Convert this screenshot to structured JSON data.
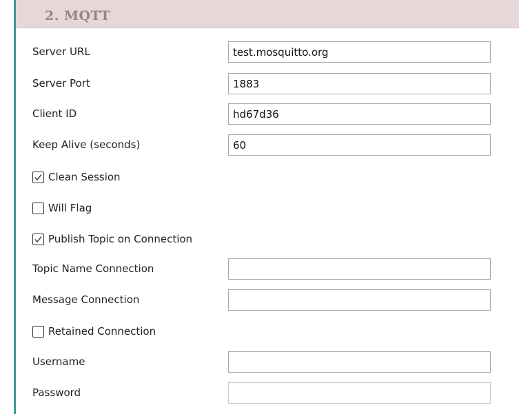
{
  "section": {
    "title": "2. MQTT"
  },
  "fields": {
    "server_url": {
      "label": "Server URL",
      "value": "test.mosquitto.org"
    },
    "server_port": {
      "label": "Server Port",
      "value": "1883"
    },
    "client_id": {
      "label": "Client ID",
      "value": "hd67d36"
    },
    "keep_alive": {
      "label": "Keep Alive (seconds)",
      "value": "60"
    },
    "topic_name_connection": {
      "label": "Topic Name Connection",
      "value": ""
    },
    "message_connection": {
      "label": "Message Connection",
      "value": ""
    },
    "username": {
      "label": "Username",
      "value": ""
    },
    "password": {
      "label": "Password",
      "value": ""
    }
  },
  "checkboxes": {
    "clean_session": {
      "label": "Clean Session",
      "checked": true
    },
    "will_flag": {
      "label": "Will Flag",
      "checked": false
    },
    "publish_topic_on_connection": {
      "label": "Publish Topic on Connection",
      "checked": true
    },
    "retained_connection": {
      "label": "Retained Connection",
      "checked": false
    }
  },
  "icons": {
    "collapse": "minus-square-icon",
    "check": "checkmark-icon"
  },
  "colors": {
    "header_background": "#e6d8d8",
    "header_title": "#9a8585",
    "left_border": "#3a9a92"
  }
}
